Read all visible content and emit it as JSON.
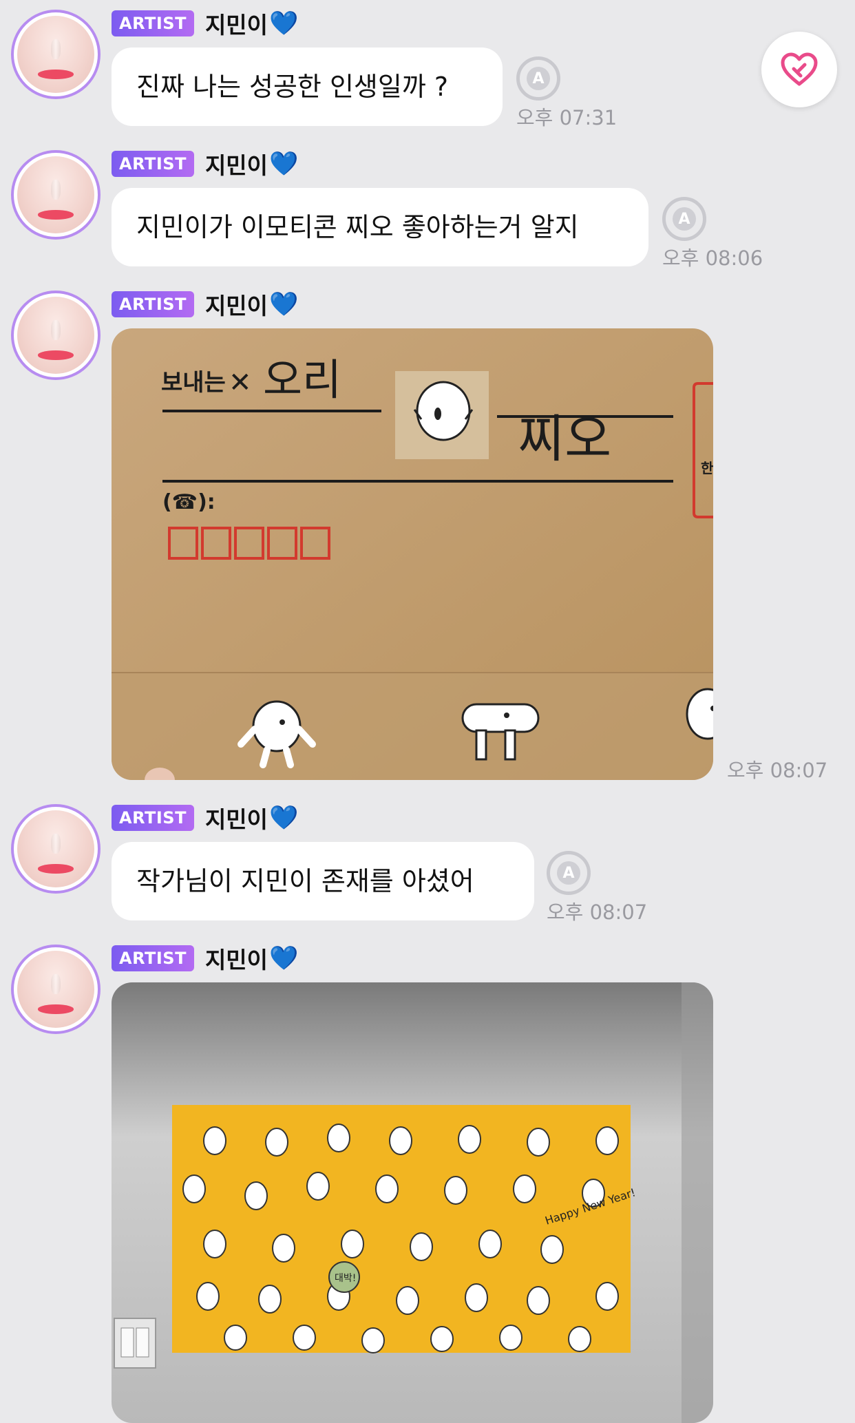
{
  "app": {
    "accent": "#7c5cf0",
    "avatar_ring": "#b78cf0",
    "background": "#e9e9eb"
  },
  "favorite": {
    "icon": "heart-outline-icon",
    "color": "#e94b8a"
  },
  "messages": [
    {
      "badge": "ARTIST",
      "nickname": "지민이",
      "heart": "💙",
      "text": "진짜 나는 성공한 인생일까 ?",
      "time": "오후 07:31"
    },
    {
      "badge": "ARTIST",
      "nickname": "지민이",
      "heart": "💙",
      "text": "지민이가 이모티콘 찌오 좋아하는거 알지",
      "time": "오후 08:06"
    },
    {
      "badge": "ARTIST",
      "nickname": "지민이",
      "heart": "💙",
      "photo": {
        "sender_label": "보내는",
        "sender_name": "오리",
        "recipient_name": "찌오",
        "phone_label": "(☎):",
        "side_mark": "한"
      },
      "time": "오후 08:07"
    },
    {
      "badge": "ARTIST",
      "nickname": "지민이",
      "heart": "💙",
      "text": "작가님이 지민이 존재를 아셨어",
      "time": "오후 08:07"
    },
    {
      "badge": "ARTIST",
      "nickname": "지민이",
      "heart": "💙",
      "photo2": {
        "greeting": "Happy New Year!",
        "speech": "대박!"
      }
    }
  ]
}
